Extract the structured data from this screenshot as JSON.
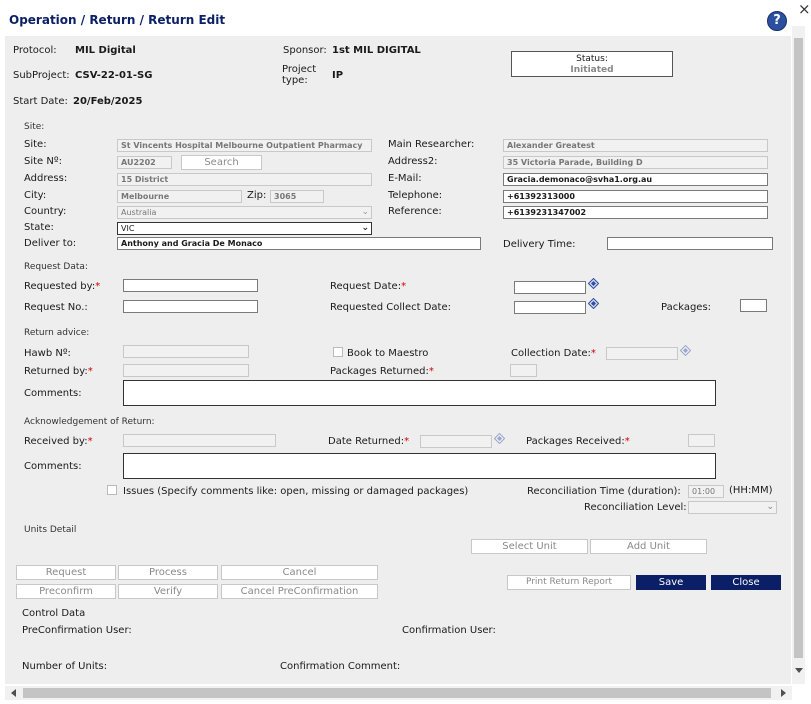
{
  "breadcrumb": "Operation / Return / Return Edit",
  "close_glyph": "×",
  "header": {
    "protocol_label": "Protocol:",
    "protocol_value": "MIL Digital",
    "sponsor_label": "Sponsor:",
    "sponsor_value": "1st MIL DIGITAL",
    "status_label": "Status:",
    "status_value": "Initiated",
    "subproject_label": "SubProject:",
    "subproject_value": "CSV-22-01-SG",
    "project_type_label": "Project type:",
    "project_type_value": "IP",
    "start_date_label": "Start Date:",
    "start_date_value": "20/Feb/2025"
  },
  "site": {
    "section_label": "Site:",
    "site_label": "Site:",
    "site_value": "St Vincents Hospital Melbourne Outpatient Pharmacy",
    "site_no_label": "Site Nº:",
    "site_no_value": "AU2202",
    "search_label": "Search",
    "address_label": "Address:",
    "address_value": "15 District",
    "city_label": "City:",
    "city_value": "Melbourne",
    "zip_label": "Zip:",
    "zip_value": "3065",
    "country_label": "Country:",
    "country_value": "Australia",
    "state_label": "State:",
    "state_value": "VIC",
    "deliver_label": "Deliver to:",
    "deliver_value": "Anthony and Gracia De Monaco",
    "main_researcher_label": "Main Researcher:",
    "main_researcher_value": "Alexander Greatest",
    "address2_label": "Address2:",
    "address2_value": "35 Victoria Parade, Building D",
    "email_label": "E-Mail:",
    "email_value": "Gracia.demonaco@svha1.org.au",
    "telephone_label": "Telephone:",
    "telephone_value": "+61392313000",
    "reference_label": "Reference:",
    "reference_value": "+6139231347002",
    "delivery_time_label": "Delivery Time:",
    "delivery_time_value": ""
  },
  "request": {
    "section_label": "Request Data:",
    "requested_by_label": "Requested by:",
    "request_date_label": "Request Date:",
    "request_no_label": "Request No.:",
    "requested_collect_label": "Requested Collect Date:",
    "packages_label": "Packages:"
  },
  "return_advice": {
    "section_label": "Return advice:",
    "hawb_label": "Hawb Nº:",
    "book_label": "Book to Maestro",
    "collection_date_label": "Collection Date:",
    "returned_by_label": "Returned by:",
    "packages_returned_label": "Packages Returned:",
    "comments_label": "Comments:"
  },
  "ack": {
    "section_label": "Acknowledgement of Return:",
    "received_by_label": "Received by:",
    "date_returned_label": "Date Returned:",
    "packages_received_label": "Packages Received:",
    "comments_label": "Comments:",
    "issues_label": "Issues (Specify comments like: open, missing or damaged packages)",
    "reconciliation_time_label": "Reconciliation Time (duration):",
    "reconciliation_time_value": "01:00",
    "hhmm_label": "(HH:MM)",
    "reconciliation_level_label": "Reconciliation Level:"
  },
  "units": {
    "section_label": "Units Detail",
    "select_unit": "Select Unit",
    "add_unit": "Add Unit"
  },
  "actions": {
    "request": "Request",
    "process": "Process",
    "cancel": "Cancel",
    "preconfirm": "Preconfirm",
    "verify": "Verify",
    "cancel_preconfirmation": "Cancel PreConfirmation",
    "print_report": "Print Return Report",
    "save": "Save",
    "close": "Close"
  },
  "control": {
    "section_label": "Control Data",
    "preconfirmation_user_label": "PreConfirmation User:",
    "confirmation_user_label": "Confirmation User:",
    "number_of_units_label": "Number of Units:",
    "confirmation_comment_label": "Confirmation Comment:"
  },
  "colors": {
    "title": "#0a1f66",
    "accent_button": "#0a1f66",
    "required": "#d00000",
    "help_icon": "#2d4fa0"
  },
  "icons": [
    "help-icon",
    "close-icon",
    "calendar-icon",
    "chevron-down-icon",
    "scroll-up-icon",
    "scroll-down-icon",
    "scroll-left-icon",
    "scroll-right-icon"
  ]
}
